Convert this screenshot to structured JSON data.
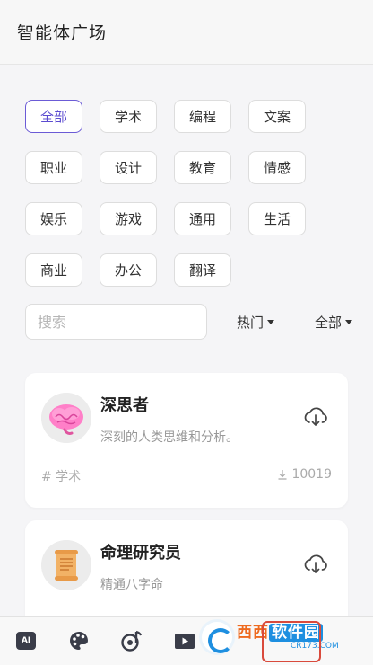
{
  "header": {
    "title": "智能体广场"
  },
  "tags": [
    {
      "label": "全部",
      "active": true
    },
    {
      "label": "学术"
    },
    {
      "label": "编程"
    },
    {
      "label": "文案"
    },
    {
      "label": "职业"
    },
    {
      "label": "设计"
    },
    {
      "label": "教育"
    },
    {
      "label": "情感"
    },
    {
      "label": "娱乐"
    },
    {
      "label": "游戏"
    },
    {
      "label": "通用"
    },
    {
      "label": "生活"
    },
    {
      "label": "商业"
    },
    {
      "label": "办公"
    },
    {
      "label": "翻译"
    }
  ],
  "search": {
    "placeholder": "搜索",
    "value": ""
  },
  "filters": {
    "sort_label": "热门",
    "scope_label": "全部"
  },
  "cards": [
    {
      "name": "深思者",
      "desc": "深刻的人类思维和分析。",
      "tag": "# 学术",
      "count": "10019"
    },
    {
      "name": "命理研究员",
      "desc": "精通八字命"
    }
  ],
  "bottom_nav": {
    "ai_label": "AI"
  },
  "watermark": {
    "main_a": "西西",
    "main_b": "软件园",
    "sub": "CR173.COM"
  },
  "colors": {
    "accent": "#5b4bd0",
    "highlight_frame": "#d94a3c"
  }
}
